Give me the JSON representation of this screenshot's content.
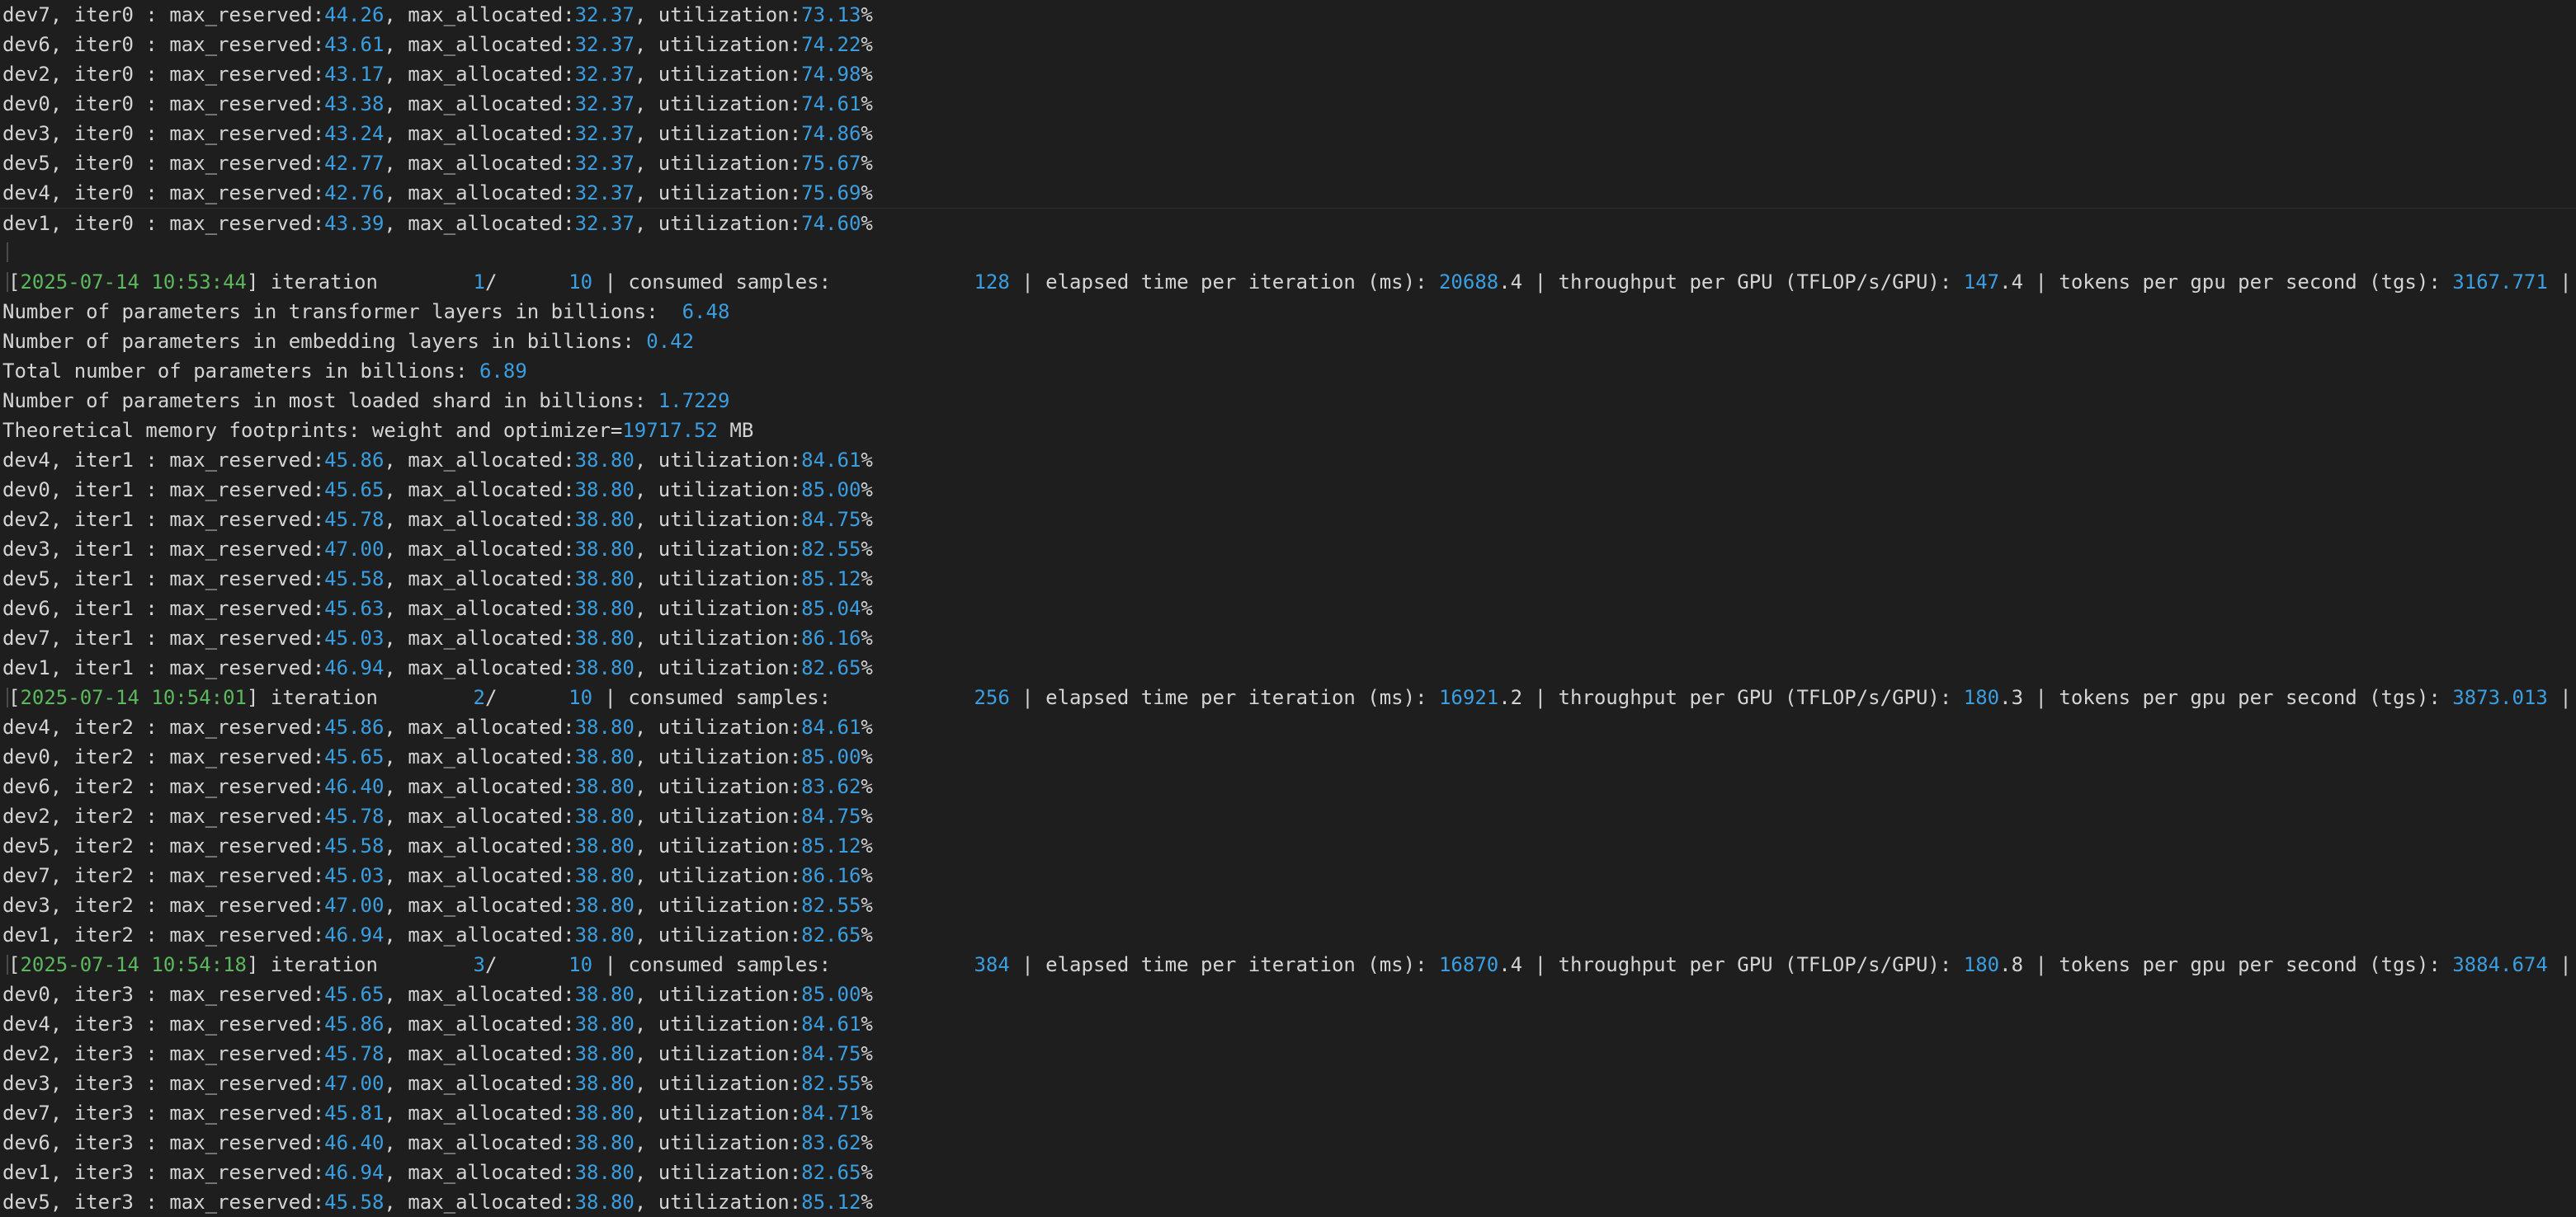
{
  "colors": {
    "background": "#1e1e1e",
    "text": "#d4d4d4",
    "number": "#3a9ee0",
    "timestamp": "#5cb85c"
  },
  "lines": [
    {
      "type": "mem",
      "dev": "dev7",
      "iter": "iter0",
      "reserved": "44.26",
      "allocated": "32.37",
      "util": "73.13"
    },
    {
      "type": "mem",
      "dev": "dev6",
      "iter": "iter0",
      "reserved": "43.61",
      "allocated": "32.37",
      "util": "74.22"
    },
    {
      "type": "mem",
      "dev": "dev2",
      "iter": "iter0",
      "reserved": "43.17",
      "allocated": "32.37",
      "util": "74.98"
    },
    {
      "type": "mem",
      "dev": "dev0",
      "iter": "iter0",
      "reserved": "43.38",
      "allocated": "32.37",
      "util": "74.61"
    },
    {
      "type": "mem",
      "dev": "dev3",
      "iter": "iter0",
      "reserved": "43.24",
      "allocated": "32.37",
      "util": "74.86"
    },
    {
      "type": "mem",
      "dev": "dev5",
      "iter": "iter0",
      "reserved": "42.77",
      "allocated": "32.37",
      "util": "75.67"
    },
    {
      "type": "mem",
      "dev": "dev4",
      "iter": "iter0",
      "reserved": "42.76",
      "allocated": "32.37",
      "util": "75.69"
    },
    {
      "type": "mem",
      "dev": "dev1",
      "iter": "iter0",
      "reserved": "43.39",
      "allocated": "32.37",
      "util": "74.60",
      "sep": true
    },
    {
      "type": "blank",
      "cursor": true
    },
    {
      "type": "iter",
      "ts": "2025-07-14 10:53:44",
      "cur": "1",
      "total": "10",
      "samples": "128",
      "elapsed": [
        "20688",
        ".4"
      ],
      "tput": [
        "147",
        ".4"
      ],
      "tgs": [
        "3167",
        ".771"
      ]
    },
    {
      "type": "info",
      "text": "Number of parameters in transformer layers in billions:  ",
      "value": "6.48"
    },
    {
      "type": "info",
      "text": "Number of parameters in embedding layers in billions: ",
      "value": "0.42"
    },
    {
      "type": "info",
      "text": "Total number of parameters in billions: ",
      "value": "6.89"
    },
    {
      "type": "info",
      "text": "Number of parameters in most loaded shard in billions: ",
      "value": "1.7229"
    },
    {
      "type": "info",
      "text": "Theoretical memory footprints: weight and optimizer=",
      "value": "19717.52",
      "suffix": " MB"
    },
    {
      "type": "mem",
      "dev": "dev4",
      "iter": "iter1",
      "reserved": "45.86",
      "allocated": "38.80",
      "util": "84.61"
    },
    {
      "type": "mem",
      "dev": "dev0",
      "iter": "iter1",
      "reserved": "45.65",
      "allocated": "38.80",
      "util": "85.00"
    },
    {
      "type": "mem",
      "dev": "dev2",
      "iter": "iter1",
      "reserved": "45.78",
      "allocated": "38.80",
      "util": "84.75"
    },
    {
      "type": "mem",
      "dev": "dev3",
      "iter": "iter1",
      "reserved": "47.00",
      "allocated": "38.80",
      "util": "82.55"
    },
    {
      "type": "mem",
      "dev": "dev5",
      "iter": "iter1",
      "reserved": "45.58",
      "allocated": "38.80",
      "util": "85.12"
    },
    {
      "type": "mem",
      "dev": "dev6",
      "iter": "iter1",
      "reserved": "45.63",
      "allocated": "38.80",
      "util": "85.04"
    },
    {
      "type": "mem",
      "dev": "dev7",
      "iter": "iter1",
      "reserved": "45.03",
      "allocated": "38.80",
      "util": "86.16"
    },
    {
      "type": "mem",
      "dev": "dev1",
      "iter": "iter1",
      "reserved": "46.94",
      "allocated": "38.80",
      "util": "82.65"
    },
    {
      "type": "iter",
      "ts": "2025-07-14 10:54:01",
      "cur": "2",
      "total": "10",
      "samples": "256",
      "elapsed": [
        "16921",
        ".2"
      ],
      "tput": [
        "180",
        ".3"
      ],
      "tgs": [
        "3873",
        ".013"
      ]
    },
    {
      "type": "mem",
      "dev": "dev4",
      "iter": "iter2",
      "reserved": "45.86",
      "allocated": "38.80",
      "util": "84.61"
    },
    {
      "type": "mem",
      "dev": "dev0",
      "iter": "iter2",
      "reserved": "45.65",
      "allocated": "38.80",
      "util": "85.00"
    },
    {
      "type": "mem",
      "dev": "dev6",
      "iter": "iter2",
      "reserved": "46.40",
      "allocated": "38.80",
      "util": "83.62"
    },
    {
      "type": "mem",
      "dev": "dev2",
      "iter": "iter2",
      "reserved": "45.78",
      "allocated": "38.80",
      "util": "84.75"
    },
    {
      "type": "mem",
      "dev": "dev5",
      "iter": "iter2",
      "reserved": "45.58",
      "allocated": "38.80",
      "util": "85.12"
    },
    {
      "type": "mem",
      "dev": "dev7",
      "iter": "iter2",
      "reserved": "45.03",
      "allocated": "38.80",
      "util": "86.16"
    },
    {
      "type": "mem",
      "dev": "dev3",
      "iter": "iter2",
      "reserved": "47.00",
      "allocated": "38.80",
      "util": "82.55"
    },
    {
      "type": "mem",
      "dev": "dev1",
      "iter": "iter2",
      "reserved": "46.94",
      "allocated": "38.80",
      "util": "82.65"
    },
    {
      "type": "iter",
      "ts": "2025-07-14 10:54:18",
      "cur": "3",
      "total": "10",
      "samples": "384",
      "elapsed": [
        "16870",
        ".4"
      ],
      "tput": [
        "180",
        ".8"
      ],
      "tgs": [
        "3884",
        ".674"
      ]
    },
    {
      "type": "mem",
      "dev": "dev0",
      "iter": "iter3",
      "reserved": "45.65",
      "allocated": "38.80",
      "util": "85.00"
    },
    {
      "type": "mem",
      "dev": "dev4",
      "iter": "iter3",
      "reserved": "45.86",
      "allocated": "38.80",
      "util": "84.61"
    },
    {
      "type": "mem",
      "dev": "dev2",
      "iter": "iter3",
      "reserved": "45.78",
      "allocated": "38.80",
      "util": "84.75"
    },
    {
      "type": "mem",
      "dev": "dev3",
      "iter": "iter3",
      "reserved": "47.00",
      "allocated": "38.80",
      "util": "82.55"
    },
    {
      "type": "mem",
      "dev": "dev7",
      "iter": "iter3",
      "reserved": "45.81",
      "allocated": "38.80",
      "util": "84.71"
    },
    {
      "type": "mem",
      "dev": "dev6",
      "iter": "iter3",
      "reserved": "46.40",
      "allocated": "38.80",
      "util": "83.62"
    },
    {
      "type": "mem",
      "dev": "dev1",
      "iter": "iter3",
      "reserved": "46.94",
      "allocated": "38.80",
      "util": "82.65"
    },
    {
      "type": "mem",
      "dev": "dev5",
      "iter": "iter3",
      "reserved": "45.58",
      "allocated": "38.80",
      "util": "85.12"
    }
  ],
  "labels": {
    "reserved": "max_reserved:",
    "allocated": "max_allocated:",
    "utilization": "utilization:",
    "iteration": "iteration",
    "consumed": "consumed samples:",
    "elapsed": "elapsed time per iteration (ms):",
    "throughput": "throughput per GPU (TFLOP/s/GPU):",
    "tgs": "tokens per gpu per second (tgs):",
    "trailing": "l"
  }
}
